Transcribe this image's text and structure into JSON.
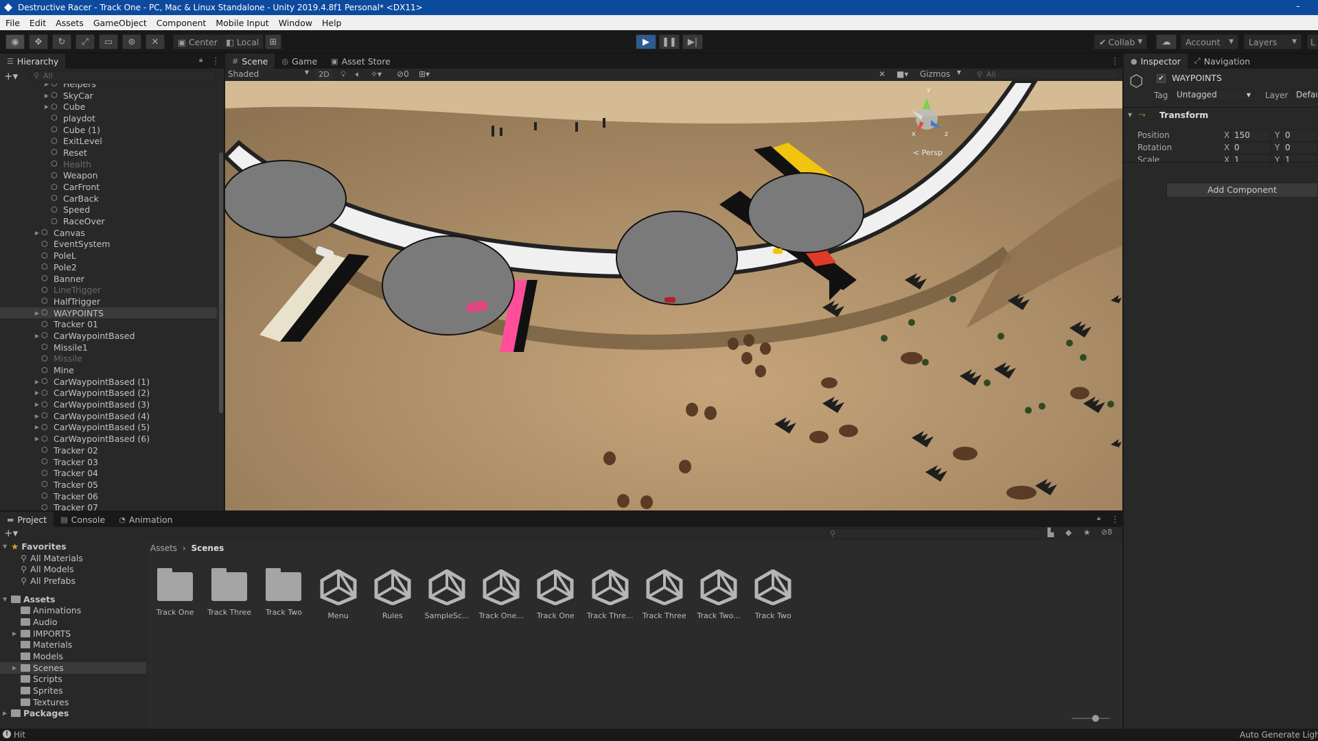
{
  "window": {
    "title": "Destructive Racer - Track One - PC, Mac & Linux Standalone - Unity 2019.4.8f1 Personal* <DX11>",
    "minimize": "–"
  },
  "menu": [
    "File",
    "Edit",
    "Assets",
    "GameObject",
    "Component",
    "Mobile Input",
    "Window",
    "Help"
  ],
  "toolbar": {
    "center": "Center",
    "local": "Local",
    "collab": "Collab",
    "account": "Account",
    "layers": "Layers",
    "layout_cut": "L"
  },
  "hierarchy": {
    "tab": "Hierarchy",
    "search_placeholder": "All",
    "items": [
      {
        "label": "Helpers",
        "indent": 4,
        "arrow": true,
        "dim": false
      },
      {
        "label": "SkyCar",
        "indent": 4,
        "arrow": true,
        "dim": false
      },
      {
        "label": "Cube",
        "indent": 4,
        "arrow": true,
        "dim": false
      },
      {
        "label": "playdot",
        "indent": 4,
        "arrow": false,
        "dim": false
      },
      {
        "label": "Cube (1)",
        "indent": 4,
        "arrow": false,
        "dim": false
      },
      {
        "label": "ExitLevel",
        "indent": 4,
        "arrow": false,
        "dim": false
      },
      {
        "label": "Reset",
        "indent": 4,
        "arrow": false,
        "dim": false
      },
      {
        "label": "Health",
        "indent": 4,
        "arrow": false,
        "dim": true
      },
      {
        "label": "Weapon",
        "indent": 4,
        "arrow": false,
        "dim": false
      },
      {
        "label": "CarFront",
        "indent": 4,
        "arrow": false,
        "dim": false
      },
      {
        "label": "CarBack",
        "indent": 4,
        "arrow": false,
        "dim": false
      },
      {
        "label": "Speed",
        "indent": 4,
        "arrow": false,
        "dim": false
      },
      {
        "label": "RaceOver",
        "indent": 4,
        "arrow": false,
        "dim": false
      },
      {
        "label": "Canvas",
        "indent": 3,
        "arrow": true,
        "dim": false
      },
      {
        "label": "EventSystem",
        "indent": 3,
        "arrow": false,
        "dim": false
      },
      {
        "label": "PoleL",
        "indent": 3,
        "arrow": false,
        "dim": false
      },
      {
        "label": "Pole2",
        "indent": 3,
        "arrow": false,
        "dim": false
      },
      {
        "label": "Banner",
        "indent": 3,
        "arrow": false,
        "dim": false
      },
      {
        "label": "LineTrigger",
        "indent": 3,
        "arrow": false,
        "dim": true
      },
      {
        "label": "HalfTrigger",
        "indent": 3,
        "arrow": false,
        "dim": false
      },
      {
        "label": "WAYPOINTS",
        "indent": 3,
        "arrow": true,
        "dim": false,
        "selected": true
      },
      {
        "label": "Tracker 01",
        "indent": 3,
        "arrow": false,
        "dim": false
      },
      {
        "label": "CarWaypointBased",
        "indent": 3,
        "arrow": true,
        "dim": false
      },
      {
        "label": "Missile1",
        "indent": 3,
        "arrow": false,
        "dim": false
      },
      {
        "label": "Missile",
        "indent": 3,
        "arrow": false,
        "dim": true
      },
      {
        "label": "Mine",
        "indent": 3,
        "arrow": false,
        "dim": false
      },
      {
        "label": "CarWaypointBased (1)",
        "indent": 3,
        "arrow": true,
        "dim": false
      },
      {
        "label": "CarWaypointBased (2)",
        "indent": 3,
        "arrow": true,
        "dim": false
      },
      {
        "label": "CarWaypointBased (3)",
        "indent": 3,
        "arrow": true,
        "dim": false
      },
      {
        "label": "CarWaypointBased (4)",
        "indent": 3,
        "arrow": true,
        "dim": false
      },
      {
        "label": "CarWaypointBased (5)",
        "indent": 3,
        "arrow": true,
        "dim": false
      },
      {
        "label": "CarWaypointBased (6)",
        "indent": 3,
        "arrow": true,
        "dim": false
      },
      {
        "label": "Tracker 02",
        "indent": 3,
        "arrow": false,
        "dim": false
      },
      {
        "label": "Tracker 03",
        "indent": 3,
        "arrow": false,
        "dim": false
      },
      {
        "label": "Tracker 04",
        "indent": 3,
        "arrow": false,
        "dim": false
      },
      {
        "label": "Tracker 05",
        "indent": 3,
        "arrow": false,
        "dim": false
      },
      {
        "label": "Tracker 06",
        "indent": 3,
        "arrow": false,
        "dim": false
      },
      {
        "label": "Tracker 07",
        "indent": 3,
        "arrow": false,
        "dim": false
      }
    ]
  },
  "scene": {
    "tabs": [
      {
        "label": "Scene",
        "icon": "#"
      },
      {
        "label": "Game",
        "icon": "◎"
      },
      {
        "label": "Asset Store",
        "icon": "▣"
      }
    ],
    "shading": "Shaded",
    "mode_2d": "2D",
    "hidden_count": "0",
    "gizmos": "Gizmos",
    "search_placeholder": "All",
    "persp": "< Persp",
    "axis_y": "y",
    "axis_x": "x",
    "axis_z": "z"
  },
  "inspector": {
    "tabs": [
      {
        "label": "Inspector"
      },
      {
        "label": "Navigation"
      }
    ],
    "object_name": "WAYPOINTS",
    "tag_label": "Tag",
    "tag_value": "Untagged",
    "layer_label": "Layer",
    "layer_value": "Defau",
    "component": "Transform",
    "rows": [
      {
        "label": "Position",
        "x": "150",
        "y": "0"
      },
      {
        "label": "Rotation",
        "x": "0",
        "y": "0"
      },
      {
        "label": "Scale",
        "x": "1",
        "y": "1"
      }
    ],
    "axis_x": "X",
    "axis_y": "Y",
    "add_component": "Add Component"
  },
  "project": {
    "tabs": [
      {
        "label": "Project"
      },
      {
        "label": "Console"
      },
      {
        "label": "Animation"
      }
    ],
    "hidden_count": "8",
    "favorites": {
      "label": "Favorites",
      "items": [
        "All Materials",
        "All Models",
        "All Prefabs"
      ]
    },
    "assets": {
      "label": "Assets",
      "items": [
        "Animations",
        "Audio",
        "IMPORTS",
        "Materials",
        "Models",
        "Scenes",
        "Scripts",
        "Sprites",
        "Textures"
      ]
    },
    "packages": "Packages",
    "breadcrumb": [
      "Assets",
      "Scenes"
    ],
    "files": [
      {
        "name": "Track One",
        "type": "folder"
      },
      {
        "name": "Track Three",
        "type": "folder"
      },
      {
        "name": "Track Two",
        "type": "folder"
      },
      {
        "name": "Menu",
        "type": "scene"
      },
      {
        "name": "Rules",
        "type": "scene"
      },
      {
        "name": "SampleSc...",
        "type": "scene"
      },
      {
        "name": "Track One...",
        "type": "scene"
      },
      {
        "name": "Track One",
        "type": "scene"
      },
      {
        "name": "Track Thre...",
        "type": "scene"
      },
      {
        "name": "Track Three",
        "type": "scene"
      },
      {
        "name": "Track Two...",
        "type": "scene"
      },
      {
        "name": "Track Two",
        "type": "scene"
      }
    ]
  },
  "status": {
    "left": "Hit",
    "right": "Auto Generate Ligh"
  },
  "colors": {
    "title_bar": "#0c4a9e",
    "play_active": "#2d5b8f",
    "selection": "#3a3a3a",
    "panel": "#282828"
  }
}
